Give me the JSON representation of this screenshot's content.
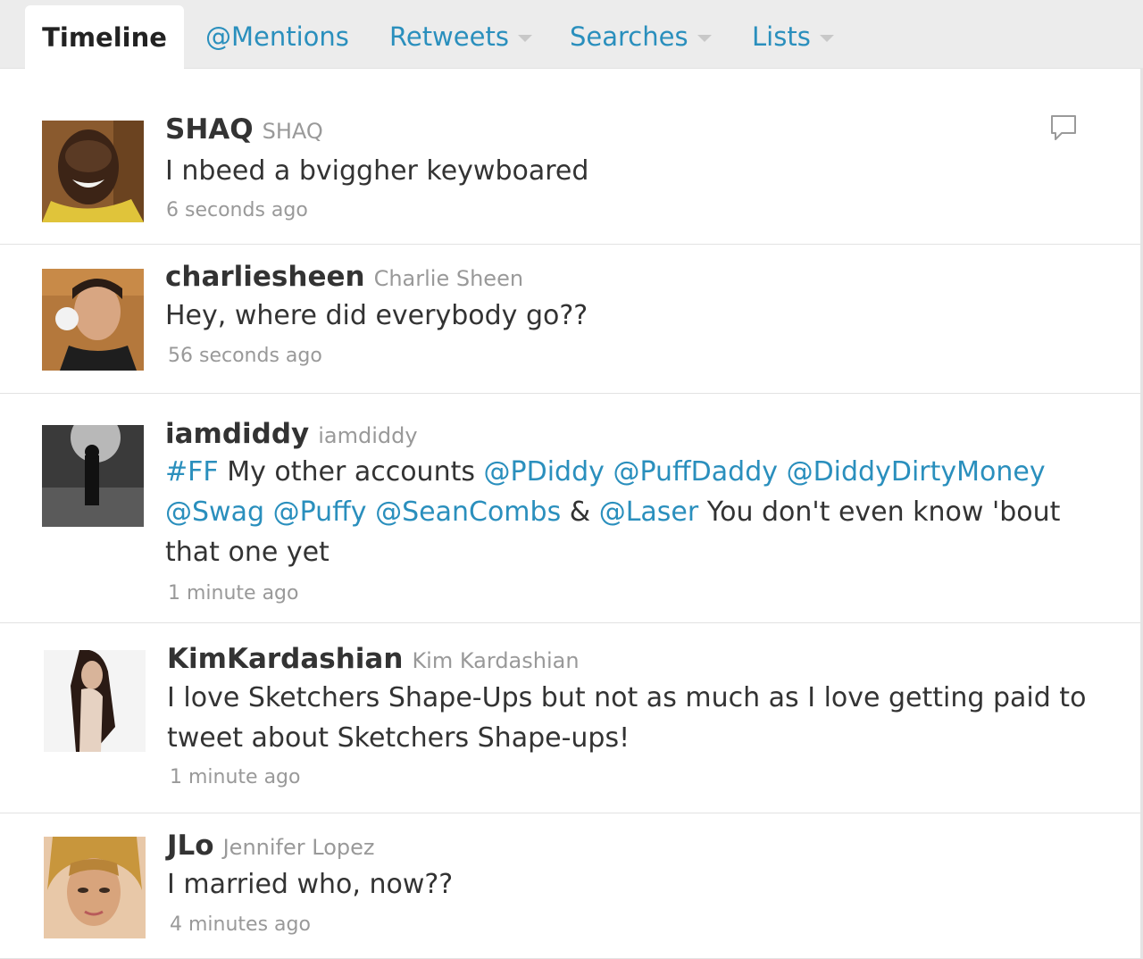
{
  "tabs": [
    {
      "label": "Timeline",
      "active": true,
      "dropdown": false
    },
    {
      "label": "@Mentions",
      "active": false,
      "dropdown": false
    },
    {
      "label": "Retweets",
      "active": false,
      "dropdown": true
    },
    {
      "label": "Searches",
      "active": false,
      "dropdown": true
    },
    {
      "label": "Lists",
      "active": false,
      "dropdown": true
    }
  ],
  "colors": {
    "link": "#2a8fbd",
    "text": "#333333",
    "muted": "#999999",
    "tab_bar": "#ececec"
  },
  "tweets": [
    {
      "screen_name": "SHAQ",
      "real_name": "SHAQ",
      "text": "I nbeed a bviggher keywboared",
      "time": "6 seconds ago",
      "icon": "reply-icon"
    },
    {
      "screen_name": "charliesheen",
      "real_name": "Charlie Sheen",
      "text": "Hey, where did everybody go??",
      "time": "56 seconds ago"
    },
    {
      "screen_name": "iamdiddy",
      "real_name": "iamdiddy",
      "segments": [
        {
          "t": "#FF",
          "link": true
        },
        {
          "t": " My other accounts ",
          "link": false
        },
        {
          "t": "@PDiddy",
          "link": true
        },
        {
          "t": " ",
          "link": false
        },
        {
          "t": "@PuffDaddy",
          "link": true
        },
        {
          "t": " ",
          "link": false
        },
        {
          "t": "@DiddyDirtyMoney",
          "link": true
        },
        {
          "t": " ",
          "link": false
        },
        {
          "t": "@Swag",
          "link": true
        },
        {
          "t": " ",
          "link": false
        },
        {
          "t": "@Puffy",
          "link": true
        },
        {
          "t": " ",
          "link": false
        },
        {
          "t": "@SeanCombs",
          "link": true
        },
        {
          "t": " & ",
          "link": false
        },
        {
          "t": "@Laser",
          "link": true
        },
        {
          "t": " You don't even know 'bout that one yet",
          "link": false
        }
      ],
      "time": "1 minute ago"
    },
    {
      "screen_name": "KimKardashian",
      "real_name": "Kim Kardashian",
      "text": "I love Sketchers Shape-Ups but not as much as I love getting paid to tweet about Sketchers Shape-ups!",
      "time": "1 minute ago"
    },
    {
      "screen_name": "JLo",
      "real_name": "Jennifer Lopez",
      "text": "I married who, now??",
      "time": "4 minutes ago"
    }
  ]
}
